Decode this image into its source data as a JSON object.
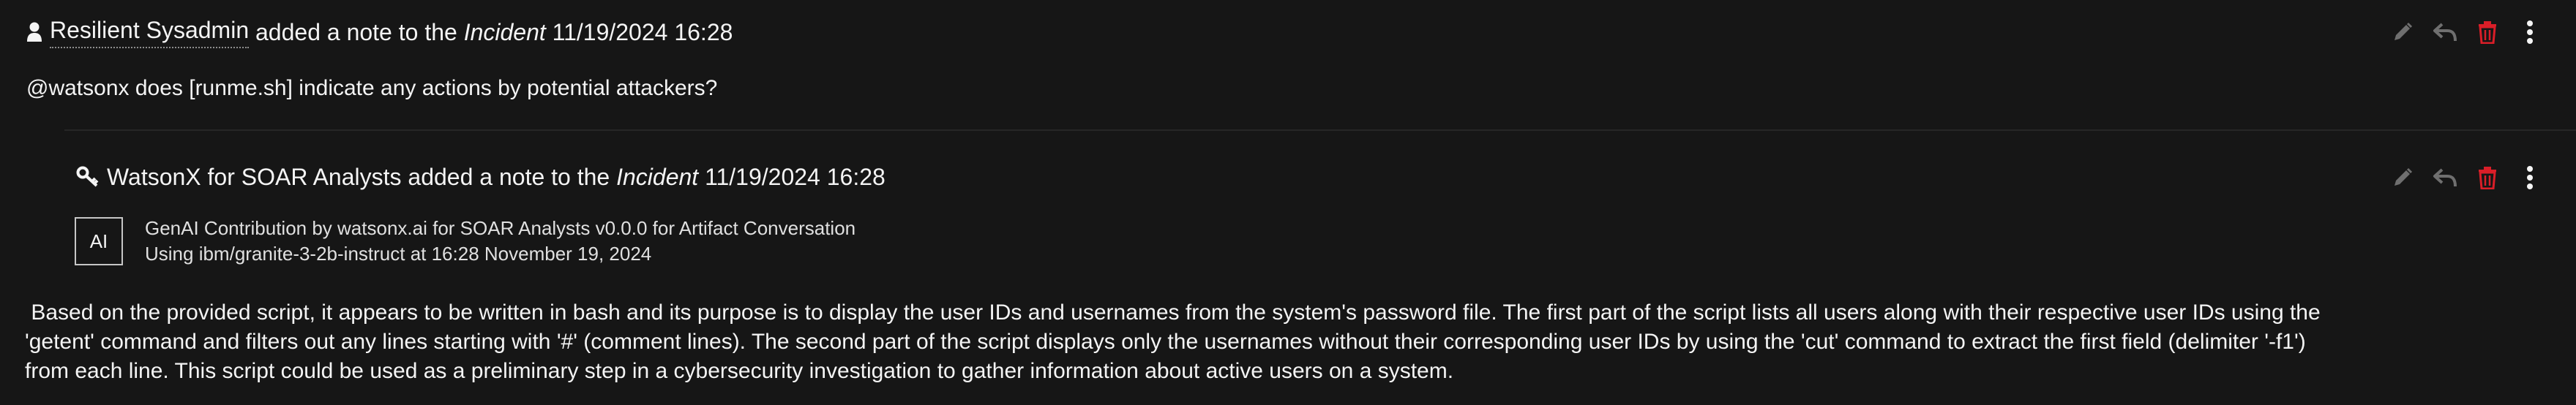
{
  "note1": {
    "author": "Resilient Sysadmin",
    "verb": "added a note to the",
    "object": "Incident",
    "timestamp": "11/19/2024 16:28",
    "text": "@watsonx does [runme.sh] indicate any actions by potential attackers?"
  },
  "note2": {
    "author": "WatsonX for SOAR Analysts",
    "verb": "added a note to the",
    "object": "Incident",
    "timestamp": "11/19/2024 16:28",
    "badge": "AI",
    "contribution_line1": "GenAI Contribution by watsonx.ai for SOAR Analysts v0.0.0 for Artifact Conversation",
    "contribution_line2": "Using ibm/granite-3-2b-instruct at 16:28 November 19, 2024",
    "paragraph_lines": [
      " Based on the provided script, it appears to be written in bash and its purpose is to display the user IDs and usernames from the system's password file. The first part of the script lists all users along with their respective user IDs using the",
      "'getent' command and filters out any lines starting with '#' (comment lines). The second part of the script displays only the usernames without their corresponding user IDs by using the 'cut' command to extract the first field (delimiter '-f1')",
      "from each line. This script could be used as a preliminary step in a cybersecurity investigation to gather information about active users on a system."
    ]
  },
  "icons": {
    "user": "user-icon",
    "key": "key-icon",
    "edit": "edit-icon",
    "reply": "reply-icon",
    "delete": "delete-icon",
    "overflow": "overflow-menu-icon"
  },
  "colors": {
    "background": "#161616",
    "text": "#f4f4f4",
    "icon_muted": "#6f6f6f",
    "delete_red": "#da1e28"
  }
}
